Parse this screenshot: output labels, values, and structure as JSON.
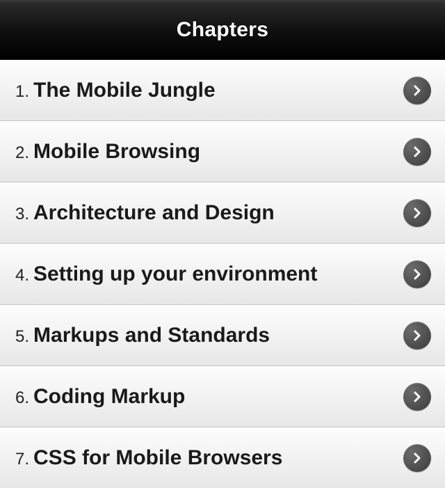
{
  "header": {
    "title": "Chapters"
  },
  "chapters": [
    {
      "number": "1.",
      "label": "The Mobile Jungle"
    },
    {
      "number": "2.",
      "label": "Mobile Browsing"
    },
    {
      "number": "3.",
      "label": "Architecture and Design"
    },
    {
      "number": "4.",
      "label": "Setting up your environment"
    },
    {
      "number": "5.",
      "label": "Markups and Standards"
    },
    {
      "number": "6.",
      "label": "Coding Markup"
    },
    {
      "number": "7.",
      "label": "CSS for Mobile Browsers"
    }
  ]
}
